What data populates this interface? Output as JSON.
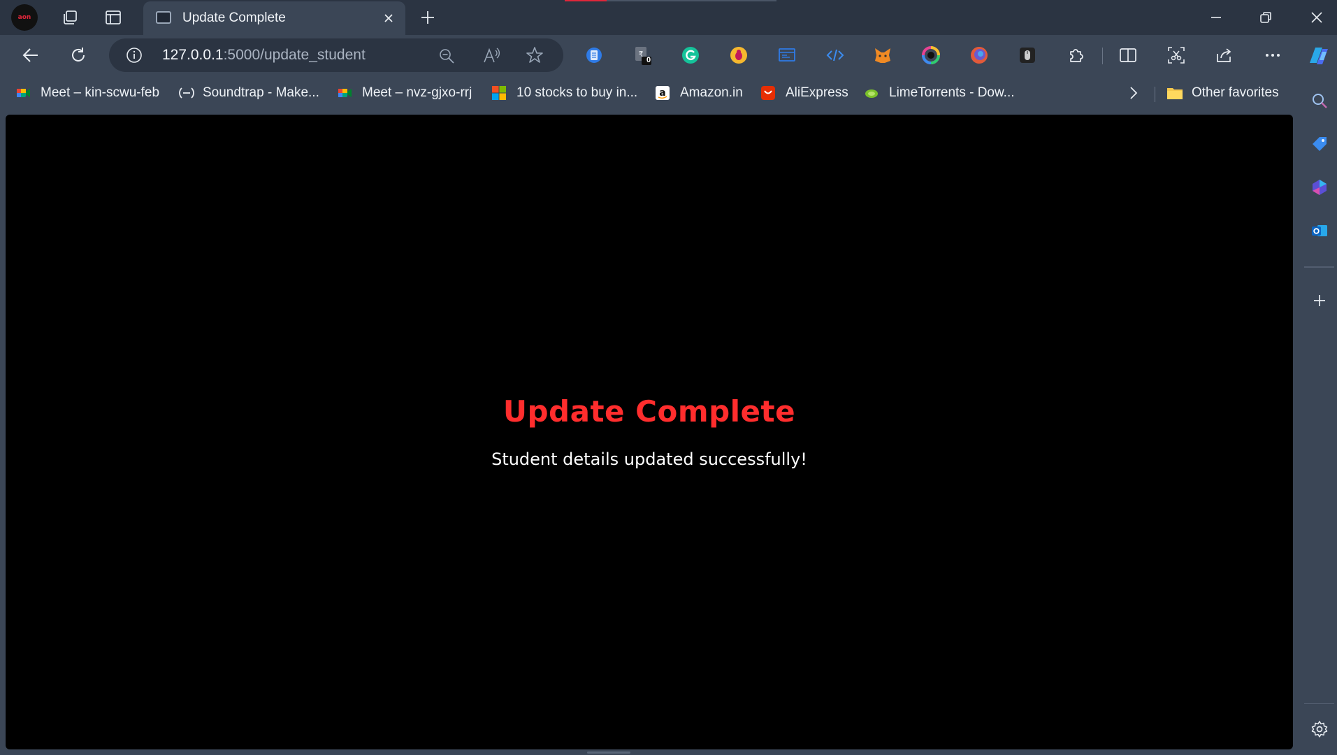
{
  "browser": {
    "profile_badge": "aon",
    "tab": {
      "title": "Update Complete"
    },
    "address": {
      "host": "127.0.0.1",
      "path": ":5000/update_student"
    },
    "extension_badge_count": "0"
  },
  "bookmarks": [
    {
      "label": "Meet – kin-scwu-feb"
    },
    {
      "label": "Soundtrap - Make..."
    },
    {
      "label": "Meet – nvz-gjxo-rrj"
    },
    {
      "label": "10 stocks to buy in..."
    },
    {
      "label": "Amazon.in"
    },
    {
      "label": "AliExpress"
    },
    {
      "label": "LimeTorrents - Dow..."
    },
    {
      "label": "Other favorites"
    }
  ],
  "page": {
    "heading": "Update Complete",
    "message": "Student details updated successfully!"
  },
  "colors": {
    "heading": "#ff2d2d",
    "page_background": "#000000",
    "chrome": "#3b4656",
    "titlebar": "#2b3442"
  }
}
